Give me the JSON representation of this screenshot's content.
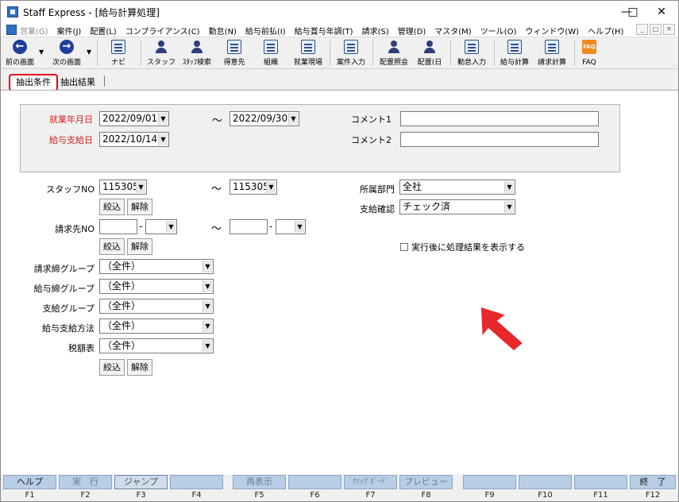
{
  "window": {
    "title": "Staff Express - [給与計算処理]",
    "controls": [
      "minimize",
      "maximize",
      "close"
    ]
  },
  "menu": {
    "items": [
      {
        "label": "営業(G)",
        "disabled": true
      },
      {
        "label": "案件(J)",
        "disabled": false
      },
      {
        "label": "配置(L)",
        "disabled": false
      },
      {
        "label": "コンプライアンス(C)",
        "disabled": false
      },
      {
        "label": "勤怠(N)",
        "disabled": false
      },
      {
        "label": "給与前払(I)",
        "disabled": false
      },
      {
        "label": "給与賞与年調(T)",
        "disabled": false
      },
      {
        "label": "請求(S)",
        "disabled": false
      },
      {
        "label": "管理(D)",
        "disabled": false
      },
      {
        "label": "マスタ(M)",
        "disabled": false
      },
      {
        "label": "ツール(O)",
        "disabled": false
      },
      {
        "label": "ウィンドウ(W)",
        "disabled": false
      },
      {
        "label": "ヘルプ(H)",
        "disabled": false
      }
    ]
  },
  "toolbar": {
    "back": "前の画面",
    "forward": "次の画面",
    "nav": "ナビ",
    "staff": "スタッフ",
    "staff_search": "ｽﾀｯﾌ検索",
    "client": "得意先",
    "org": "組織",
    "worksite": "就業現場",
    "case_input": "案件入力",
    "assign_inquiry": "配置照会",
    "assign_day": "配置(日",
    "attendance_input": "勤怠入力",
    "payroll_calc": "給与計算",
    "billing_calc": "請求計算",
    "faq": "FAQ"
  },
  "tabs": {
    "conditions": "抽出条件",
    "results": "抽出結果"
  },
  "form": {
    "work_date_label": "就業年月日",
    "work_date_from": "2022/09/01",
    "work_date_to": "2022/09/30",
    "tilde": "～",
    "pay_date_label": "給与支給日",
    "pay_date": "2022/10/14",
    "comment1_label": "コメント1",
    "comment1_value": "",
    "comment2_label": "コメント2",
    "comment2_value": "",
    "staff_no_label": "スタッフNO",
    "staff_no_from": "115305",
    "staff_no_to": "115305",
    "narrow_label": "絞込",
    "clear_label": "解除",
    "dept_label": "所属部門",
    "dept_value": "全社",
    "pay_confirm_label": "支給確認",
    "pay_confirm_value": "チェック済",
    "billing_no_label": "請求先NO",
    "after_exec_label": "実行後に処理結果を表示する",
    "billing_close_group_label": "請求締グループ",
    "billing_close_group_value": "（全件）",
    "pay_close_group_label": "給与締グループ",
    "pay_close_group_value": "（全件）",
    "pay_group_label": "支給グループ",
    "pay_group_value": "（全件）",
    "pay_method_label": "給与支給方法",
    "pay_method_value": "（全件）",
    "tax_table_label": "税額表",
    "tax_table_value": "（全件）"
  },
  "fkeys": [
    {
      "label": "ヘルプ",
      "key": "F1"
    },
    {
      "label": "実　行",
      "key": "F2"
    },
    {
      "label": "ジャンプ",
      "key": "F3"
    },
    {
      "label": "",
      "key": "F4"
    },
    {
      "label": "再表示",
      "key": "F5"
    },
    {
      "label": "",
      "key": "F6"
    },
    {
      "label": "ｸﾘｯﾌﾟﾎﾞｰﾄﾞ",
      "key": "F7"
    },
    {
      "label": "プレビュー",
      "key": "F8"
    },
    {
      "label": "",
      "key": "F9"
    },
    {
      "label": "",
      "key": "F10"
    },
    {
      "label": "",
      "key": "F11"
    },
    {
      "label": "終　了",
      "key": "F12"
    }
  ],
  "colors": {
    "accent_red": "#e6001a",
    "required_label_red": "#d92020",
    "fkey_blue": "#b8cde6",
    "arrow_red": "#e8282a"
  }
}
